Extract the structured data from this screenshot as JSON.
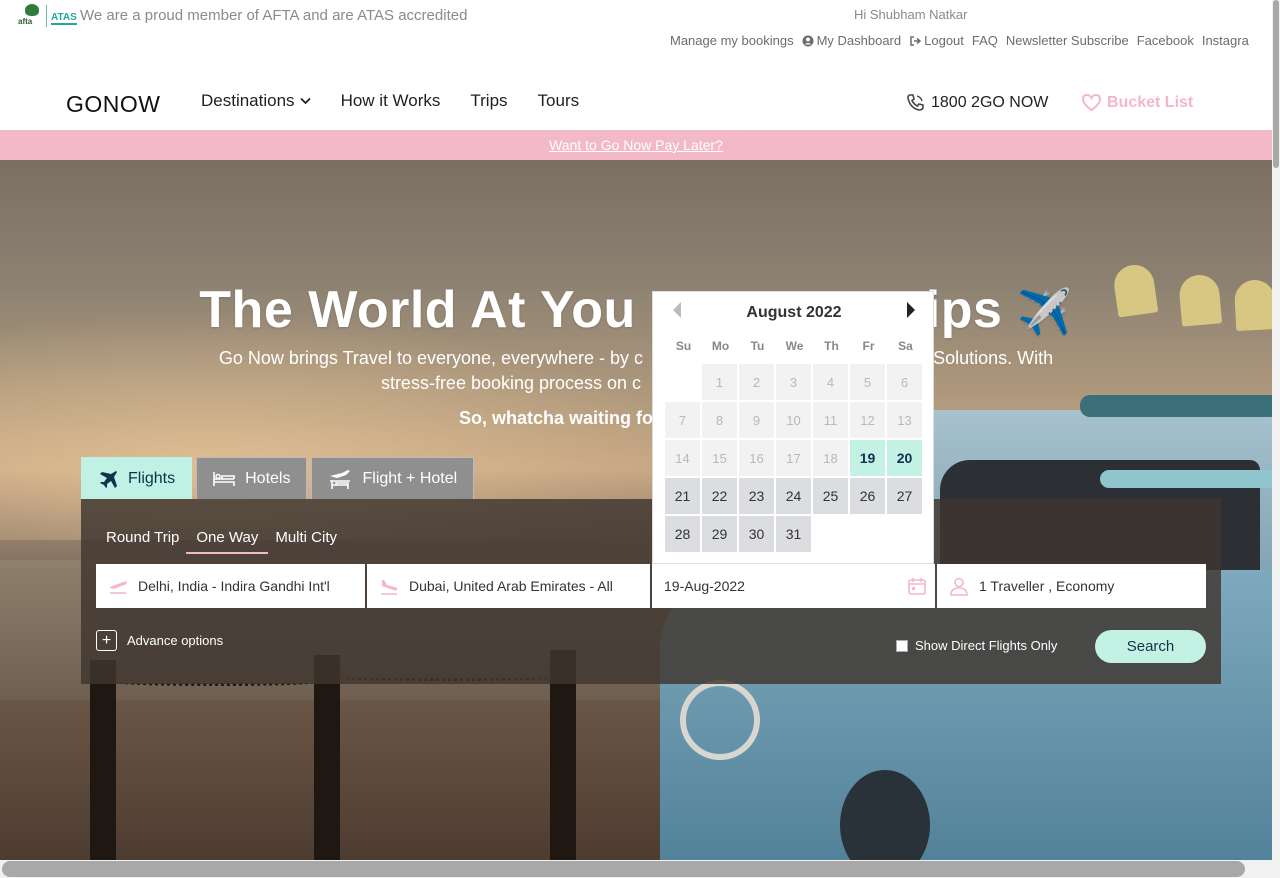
{
  "topbar": {
    "afta_logo_text": "afta",
    "atas_logo_text": "ATAS",
    "member_text": "We are a proud member of AFTA and are ATAS accredited",
    "greeting": "Hi Shubham Natkar",
    "links": {
      "manage_bookings": "Manage my bookings",
      "dashboard": "My Dashboard",
      "logout": "Logout",
      "faq": "FAQ",
      "newsletter": "Newsletter Subscribe",
      "facebook": "Facebook",
      "instagram": "Instagra"
    }
  },
  "nav": {
    "brand": "GONOW",
    "items": {
      "destinations": "Destinations",
      "how_it_works": "How it Works",
      "trips": "Trips",
      "tours": "Tours"
    },
    "phone": "1800 2GO NOW",
    "bucket_list": "Bucket List"
  },
  "promo": {
    "link": "Want to Go Now Pay Later?"
  },
  "hero": {
    "title_part1": "The World At You",
    "title_part2": "ips",
    "plane_glyph": "✈️",
    "subtitle_line1": "Go Now brings Travel to everyone, everywhere - by c",
    "subtitle_line1b": "Solutions. With",
    "subtitle_line2": "stress-free booking process on c",
    "cta": "So, whatcha waiting fo"
  },
  "booking": {
    "tabs": {
      "flights": "Flights",
      "hotels": "Hotels",
      "flight_hotel": "Flight + Hotel"
    },
    "trip_types": {
      "round_trip": "Round Trip",
      "one_way": "One Way",
      "multi_city": "Multi City"
    },
    "from": "Delhi, India - Indira Gandhi Int'l",
    "to": "Dubai, United Arab Emirates - All",
    "date": "19-Aug-2022",
    "travellers": "1 Traveller , Economy",
    "advance_options": "Advance options",
    "direct_only": "Show Direct Flights Only",
    "search": "Search"
  },
  "calendar": {
    "month": "August 2022",
    "weekdays": [
      "Su",
      "Mo",
      "Tu",
      "We",
      "Th",
      "Fr",
      "Sa"
    ],
    "days": [
      {
        "d": "",
        "s": "empty"
      },
      {
        "d": "1",
        "s": "disabled"
      },
      {
        "d": "2",
        "s": "disabled"
      },
      {
        "d": "3",
        "s": "disabled"
      },
      {
        "d": "4",
        "s": "disabled"
      },
      {
        "d": "5",
        "s": "disabled"
      },
      {
        "d": "6",
        "s": "disabled"
      },
      {
        "d": "7",
        "s": "disabled"
      },
      {
        "d": "8",
        "s": "disabled"
      },
      {
        "d": "9",
        "s": "disabled"
      },
      {
        "d": "10",
        "s": "disabled"
      },
      {
        "d": "11",
        "s": "disabled"
      },
      {
        "d": "12",
        "s": "disabled"
      },
      {
        "d": "13",
        "s": "disabled"
      },
      {
        "d": "14",
        "s": "disabled"
      },
      {
        "d": "15",
        "s": "disabled"
      },
      {
        "d": "16",
        "s": "disabled"
      },
      {
        "d": "17",
        "s": "disabled"
      },
      {
        "d": "18",
        "s": "disabled"
      },
      {
        "d": "19",
        "s": "hl"
      },
      {
        "d": "20",
        "s": "hl"
      },
      {
        "d": "21",
        "s": "avail"
      },
      {
        "d": "22",
        "s": "avail"
      },
      {
        "d": "23",
        "s": "avail"
      },
      {
        "d": "24",
        "s": "avail"
      },
      {
        "d": "25",
        "s": "avail"
      },
      {
        "d": "26",
        "s": "avail"
      },
      {
        "d": "27",
        "s": "avail"
      },
      {
        "d": "28",
        "s": "avail"
      },
      {
        "d": "29",
        "s": "avail"
      },
      {
        "d": "30",
        "s": "avail"
      },
      {
        "d": "31",
        "s": "avail"
      }
    ]
  },
  "colors": {
    "accent_mint": "#c3f2e4",
    "accent_pink": "#f4b9c8",
    "navy": "#10324a"
  }
}
